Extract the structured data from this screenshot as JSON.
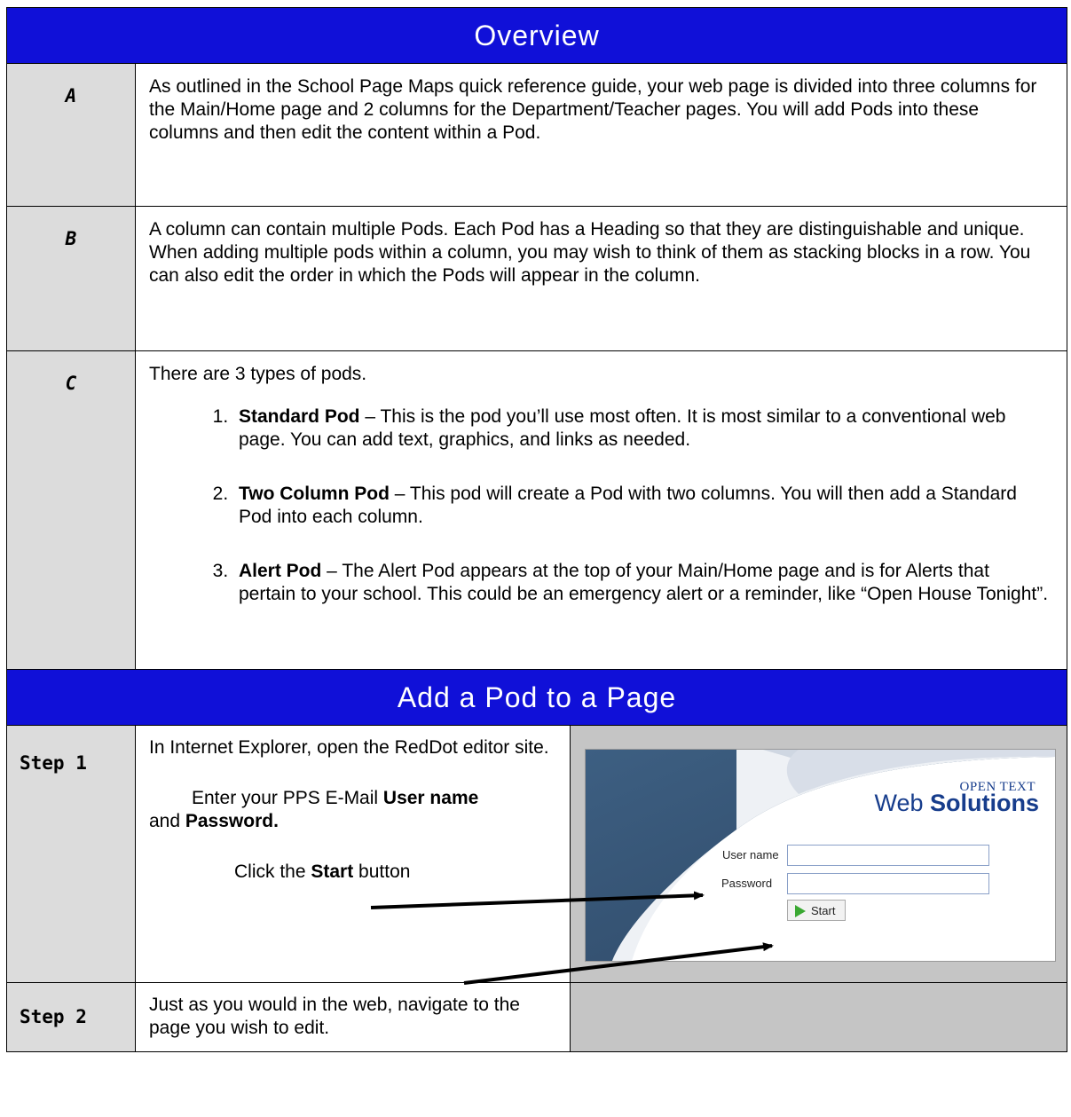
{
  "overview": {
    "heading": "Overview",
    "rows": [
      {
        "label": "A",
        "text": "As outlined in the School Page Maps quick reference guide, your web page is divided into three columns for the Main/Home page and 2 columns for the Department/Teacher pages. You will add Pods into these columns and then edit the content within a Pod."
      },
      {
        "label": "B",
        "text": "A column can contain multiple Pods.  Each Pod has a Heading so that they are distinguishable and unique.  When adding multiple pods within a column, you may wish to think of them as stacking blocks in a row.  You can also edit the order in which the Pods will appear in the column."
      },
      {
        "label": "C",
        "intro": "There are 3 types of pods.",
        "items": [
          {
            "name": "Standard Pod",
            "text": " – This is the pod you’ll use most often.  It is most similar to a conventional web page.  You can add text, graphics, and links as needed."
          },
          {
            "name": "Two Column Pod",
            "text": " – This pod will create a Pod with two columns.  You will then add a Standard Pod into each column."
          },
          {
            "name": "Alert Pod",
            "text": " – The Alert Pod appears at the top of your Main/Home page and is for Alerts that pertain to your school.  This could be an emergency alert or a reminder, like “Open House Tonight”."
          }
        ]
      }
    ]
  },
  "add_pod": {
    "heading": "Add a Pod to a Page",
    "step1": {
      "label": "Step 1",
      "line1": "In Internet Explorer, open the RedDot editor site.",
      "line2_pre": "Enter your PPS E-Mail ",
      "line2_user": "User name",
      "line2_and": "and ",
      "line2_pass": "Password.",
      "line3_pre": "Click the ",
      "line3_start": "Start",
      "line3_post": " button"
    },
    "screenshot": {
      "logo_top": "OPEN TEXT",
      "logo_web": "Web ",
      "logo_solutions": "Solutions",
      "username_label": "User name",
      "password_label": "Password",
      "start_label": "Start"
    },
    "step2": {
      "label": "Step 2",
      "text": "Just as you would in the web, navigate to the page you wish to edit."
    }
  },
  "colors": {
    "banner": "#1010d8",
    "label_bg": "#dcdcdc",
    "screenshot_bg": "#c5c5c5"
  }
}
